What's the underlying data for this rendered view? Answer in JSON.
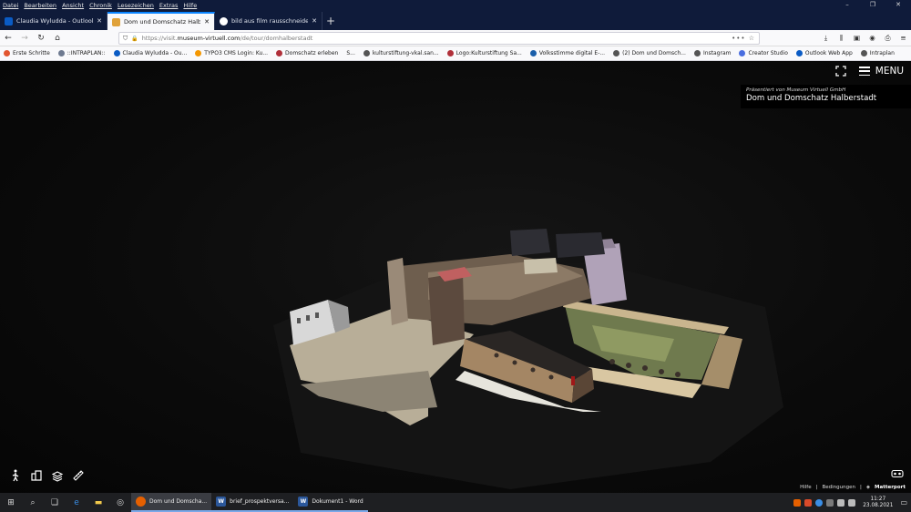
{
  "menubar": {
    "items": [
      "Datei",
      "Bearbeiten",
      "Ansicht",
      "Chronik",
      "Lesezeichen",
      "Extras",
      "Hilfe"
    ],
    "controls": [
      "–",
      "❐",
      "✕"
    ]
  },
  "tabs": [
    {
      "label": "Claudia Wyludda - Outlook We",
      "color": "#0a5bc4",
      "active": false
    },
    {
      "label": "Dom und Domschatz Halberstadt",
      "color": "#e0a23a",
      "active": true
    },
    {
      "label": "bild aus film rausschneiden - G",
      "color": "#ffffff",
      "active": false
    }
  ],
  "navbar": {
    "url_prefix": "https://visit.",
    "url_domain": "museum-virtuell.com",
    "url_path": "/de/tour/domhalberstadt",
    "url_tail": "••• ☆"
  },
  "bookmarks": [
    {
      "label": "Erste Schritte",
      "color": "#e2552f"
    },
    {
      "label": "::INTRAPLAN::",
      "color": "#6e7a90"
    },
    {
      "label": "Claudia Wyludda - Ou...",
      "color": "#0a5bc4"
    },
    {
      "label": "TYPO3 CMS Login: Ku...",
      "color": "#f49700"
    },
    {
      "label": "Domschatz erleben",
      "color": "#b0303a"
    },
    {
      "label": "S...",
      "color": "#888888"
    },
    {
      "label": "kulturstiftung-vkal.san...",
      "color": "#555555"
    },
    {
      "label": "Logo:Kulturstiftung Sa...",
      "color": "#b0303a"
    },
    {
      "label": "Volksstimme digital E-...",
      "color": "#1b5faa"
    },
    {
      "label": "(2) Dom und Domsch...",
      "color": "#555555"
    },
    {
      "label": "Instagram",
      "color": "#555555"
    },
    {
      "label": "Creator Studio",
      "color": "#4a6ee0"
    },
    {
      "label": "Outlook Web App",
      "color": "#0a5bc4"
    },
    {
      "label": "Intraplan",
      "color": "#555555"
    }
  ],
  "viewer": {
    "menu_label": "MENU",
    "presented_by": "Präsentiert von Museum Virtuell GmbH",
    "tour_title": "Dom und Domschatz Halberstadt",
    "footer_help": "Hilfe",
    "footer_terms": "Bedingungen",
    "footer_brand": "Matterport"
  },
  "taskbar": {
    "tasks": [
      {
        "label": "Dom und Domscha...",
        "icon": "firefox-icon",
        "color": "#e66000",
        "active": true
      },
      {
        "label": "brief_prospektversa...",
        "icon": "word-icon",
        "color": "#2b579a",
        "active": false
      },
      {
        "label": "Dokument1 - Word",
        "icon": "word-icon",
        "color": "#2b579a",
        "active": false
      }
    ],
    "time": "11:27",
    "date": "23.08.2021"
  }
}
